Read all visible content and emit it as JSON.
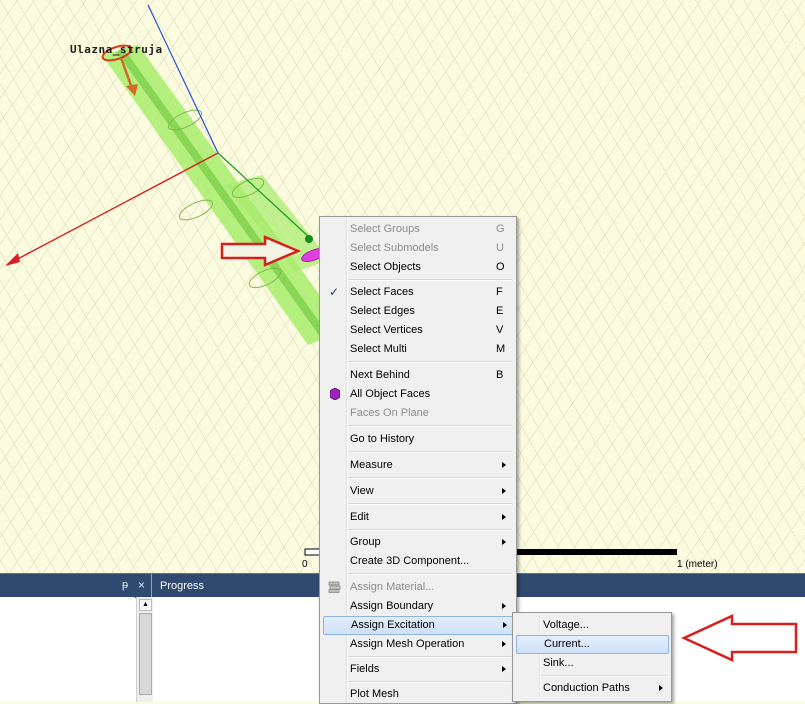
{
  "viewport": {
    "excitation_label": "Ulazna_struja",
    "scale": {
      "zero": "0",
      "unit": "1 (meter)"
    }
  },
  "panel": {
    "pin_glyph": "ᵽ",
    "close_glyph": "×",
    "progress_title": "Progress"
  },
  "context_menu": {
    "items": [
      {
        "label": "Select Groups",
        "key": "G",
        "disabled": true
      },
      {
        "label": "Select Submodels",
        "key": "U",
        "disabled": true
      },
      {
        "label": "Select Objects",
        "key": "O"
      },
      {
        "label": "Select Faces",
        "key": "F",
        "checked": true
      },
      {
        "label": "Select Edges",
        "key": "E"
      },
      {
        "label": "Select Vertices",
        "key": "V"
      },
      {
        "label": "Select Multi",
        "key": "M"
      },
      {
        "label": "Next Behind",
        "key": "B"
      },
      {
        "label": "All Object Faces",
        "icon": "hexagon-face-icon"
      },
      {
        "label": "Faces On Plane",
        "disabled": true
      },
      {
        "label": "Go to History"
      },
      {
        "label": "Measure",
        "submenu": true
      },
      {
        "label": "View",
        "submenu": true
      },
      {
        "label": "Edit",
        "submenu": true
      },
      {
        "label": "Group",
        "submenu": true
      },
      {
        "label": "Create 3D Component..."
      },
      {
        "label": "Assign Material...",
        "disabled": true,
        "icon": "material-icon"
      },
      {
        "label": "Assign Boundary",
        "submenu": true
      },
      {
        "label": "Assign Excitation",
        "submenu": true,
        "highlighted": true
      },
      {
        "label": "Assign Mesh Operation",
        "submenu": true
      },
      {
        "label": "Fields",
        "submenu": true
      },
      {
        "label": "Plot Mesh"
      }
    ]
  },
  "submenu": {
    "items": [
      {
        "label": "Voltage..."
      },
      {
        "label": "Current...",
        "highlighted": true
      },
      {
        "label": "Sink..."
      },
      {
        "label": "Conduction Paths",
        "submenu": true
      }
    ]
  },
  "colors": {
    "grid_background": "#fbfbe0",
    "grid_lines": "#d6d6b0",
    "conductor": "#a8ec6c",
    "annotation_arrow": "#d62020",
    "panel_header": "#2f4a6e",
    "face_highlight": "#e040e0",
    "x_axis": "#e02020",
    "y_axis": "#20a020",
    "z_axis": "#2050e0"
  }
}
